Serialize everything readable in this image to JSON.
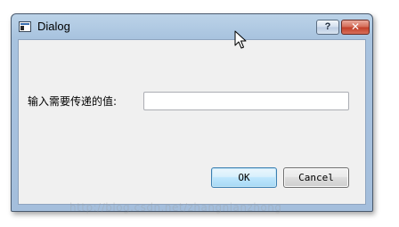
{
  "window": {
    "title": "Dialog",
    "help_label": "?",
    "close_label": "✕"
  },
  "form": {
    "label": "输入需要传递的值:",
    "input_value": ""
  },
  "buttons": {
    "ok_label": "OK",
    "cancel_label": "Cancel"
  },
  "watermark": {
    "text": "http://blog.csdn.net/zhangnianzhong"
  },
  "colors": {
    "title_bar": "#a8c3df",
    "client_bg": "#f0f0f0",
    "close_button": "#c9462e",
    "ok_button": "#bee6fd"
  },
  "icons": [
    "window-app-icon",
    "help-icon",
    "close-icon",
    "mouse-cursor-icon"
  ]
}
